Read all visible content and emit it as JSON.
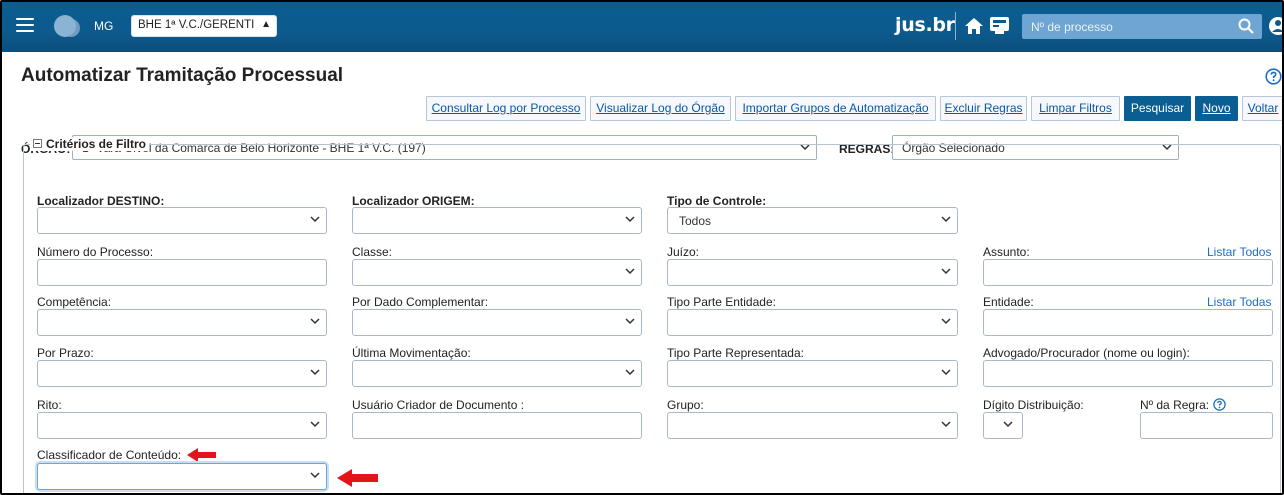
{
  "header": {
    "state": "MG",
    "org_select_value": "BHE 1ª V.C./GERENTI",
    "brand": "jus.br",
    "search_placeholder": "Nº de processo",
    "colors": {
      "topbar": "#0d5a8d",
      "primary_button": "#0b5e92",
      "link": "#1a6fc7"
    },
    "icons": [
      "menu-icon",
      "app-logo",
      "home-icon",
      "mail-icon",
      "search-icon",
      "user-icon"
    ]
  },
  "page": {
    "title": "Automatizar Tramitação Processual",
    "help_icon": "help-icon"
  },
  "toolbar": {
    "consultar_log": "Consultar Log por Processo",
    "visualizar_log": "Visualizar Log do Órgão",
    "importar_grupos": "Importar Grupos de Automatização",
    "excluir_regras": "Excluir Regras",
    "limpar_filtros": "Limpar Filtros",
    "pesquisar": "Pesquisar",
    "novo": "Novo",
    "voltar": "Voltar"
  },
  "orgao": {
    "label": "ÓRGÃO:",
    "value": "1ª Vara Cível da Comarca de Belo Horizonte - BHE 1ª V.C. (197)"
  },
  "regras": {
    "label": "REGRAS:",
    "value": "Órgão Selecionado"
  },
  "filtros": {
    "legend": "Critérios de Filtro",
    "localizador_destino": {
      "label": "Localizador DESTINO:",
      "value": ""
    },
    "localizador_origem": {
      "label": "Localizador ORIGEM:",
      "value": ""
    },
    "tipo_controle": {
      "label": "Tipo de Controle:",
      "value": "Todos"
    },
    "numero_processo": {
      "label": "Número do Processo:",
      "value": ""
    },
    "classe": {
      "label": "Classe:",
      "value": ""
    },
    "juizo": {
      "label": "Juízo:",
      "value": ""
    },
    "assunto": {
      "label": "Assunto:",
      "link": "Listar Todos",
      "value": ""
    },
    "competencia": {
      "label": "Competência:",
      "value": ""
    },
    "por_dado_complementar": {
      "label": "Por Dado Complementar:",
      "value": ""
    },
    "tipo_parte_entidade": {
      "label": "Tipo Parte Entidade:",
      "value": ""
    },
    "entidade": {
      "label": "Entidade:",
      "link": "Listar Todas",
      "value": ""
    },
    "por_prazo": {
      "label": "Por Prazo:",
      "value": ""
    },
    "ultima_movimentacao": {
      "label": "Última Movimentação:",
      "value": ""
    },
    "tipo_parte_representada": {
      "label": "Tipo Parte Representada:",
      "value": ""
    },
    "advogado_procurador": {
      "label": "Advogado/Procurador (nome ou login):",
      "value": ""
    },
    "rito": {
      "label": "Rito:",
      "value": ""
    },
    "usuario_criador": {
      "label": "Usuário Criador de Documento :",
      "value": ""
    },
    "grupo": {
      "label": "Grupo:",
      "value": ""
    },
    "digito_distribuicao": {
      "label": "Dígito Distribuição:",
      "value": ""
    },
    "numero_regra": {
      "label": "Nº da Regra:",
      "value": ""
    },
    "classificador_conteudo": {
      "label": "Classificador de Conteúdo:",
      "value": ""
    }
  },
  "annotations": {
    "arrow_color": "#e3151b"
  }
}
